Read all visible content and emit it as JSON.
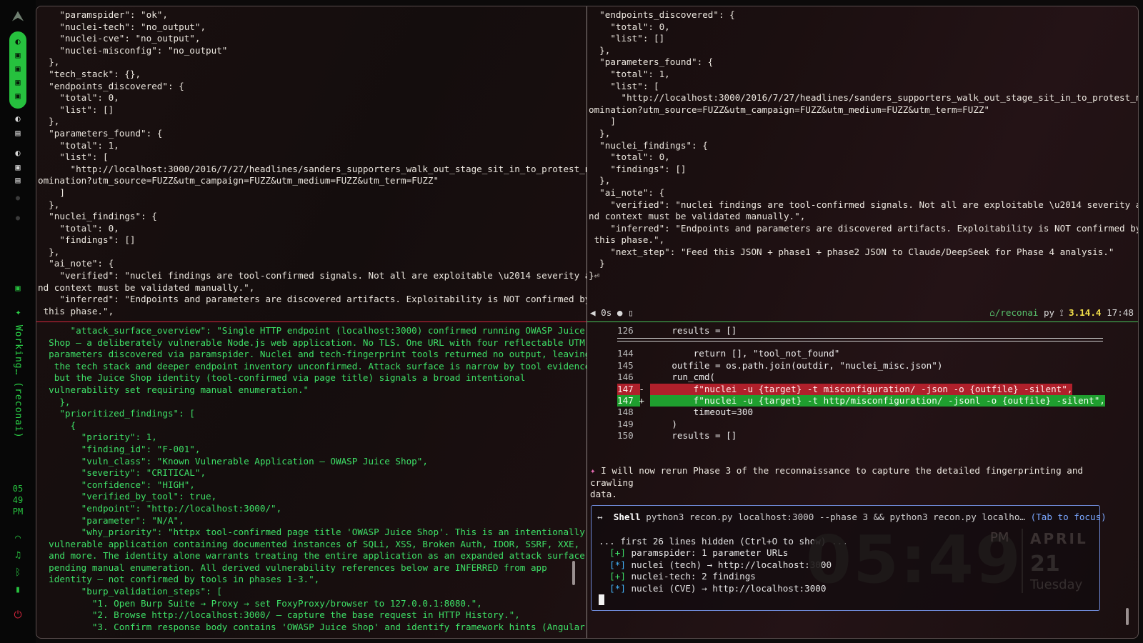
{
  "sidebar": {
    "logo_icon": "arch-logo-icon",
    "status_vertical": "✦ Working… (reconai)",
    "clock": [
      "05",
      "49",
      "PM"
    ],
    "bottom_icons": [
      "wifi-icon",
      "audio-icon",
      "bluetooth-icon",
      "battery-icon",
      "power-icon"
    ]
  },
  "panes": {
    "top_left": {
      "lines": [
        "    \"paramspider\": \"ok\",",
        "    \"nuclei-tech\": \"no_output\",",
        "    \"nuclei-cve\": \"no_output\",",
        "    \"nuclei-misconfig\": \"no_output\"",
        "  },",
        "  \"tech_stack\": {},",
        "  \"endpoints_discovered\": {",
        "    \"total\": 0,",
        "    \"list\": []",
        "  },",
        "  \"parameters_found\": {",
        "    \"total\": 1,",
        "    \"list\": [",
        "      \"http://localhost:3000/2016/7/27/headlines/sanders_supporters_walk_out_stage_sit_in_to_protest_n",
        "omination?utm_source=FUZZ&utm_campaign=FUZZ&utm_medium=FUZZ&utm_term=FUZZ\"",
        "    ]",
        "  },",
        "  \"nuclei_findings\": {",
        "    \"total\": 0,",
        "    \"findings\": []",
        "  },",
        "  \"ai_note\": {",
        "    \"verified\": \"nuclei findings are tool-confirmed signals. Not all are exploitable \\u2014 severity a",
        "nd context must be validated manually.\",",
        "    \"inferred\": \"Endpoints and parameters are discovered artifacts. Exploitability is NOT confirmed by",
        " this phase.\","
      ]
    },
    "top_right": {
      "lines": [
        "  \"endpoints_discovered\": {",
        "    \"total\": 0,",
        "    \"list\": []",
        "  },",
        "  \"parameters_found\": {",
        "    \"total\": 1,",
        "    \"list\": [",
        "      \"http://localhost:3000/2016/7/27/headlines/sanders_supporters_walk_out_stage_sit_in_to_protest_n",
        "omination?utm_source=FUZZ&utm_campaign=FUZZ&utm_medium=FUZZ&utm_term=FUZZ\"",
        "    ]",
        "  },",
        "  \"nuclei_findings\": {",
        "    \"total\": 0,",
        "    \"findings\": []",
        "  },",
        "  \"ai_note\": {",
        "    \"verified\": \"nuclei findings are tool-confirmed signals. Not all are exploitable \\u2014 severity a",
        "nd context must be validated manually.\",",
        "    \"inferred\": \"Endpoints and parameters are discovered artifacts. Exploitability is NOT confirmed by",
        " this phase.\",",
        "    \"next_step\": \"Feed this JSON + phase1 + phase2 JSON to Claude/DeepSeek for Phase 4 analysis.\"",
        "  }",
        "}⏎"
      ],
      "status_left": "◀ 0s ● ▯",
      "status_dir": "⌂/reconai",
      "status_lang": " py ⟟ ",
      "status_pyver": "3.14.4",
      "status_time": " 17:48"
    },
    "bottom_left": {
      "lines": [
        "      \"attack_surface_overview\": \"Single HTTP endpoint (localhost:3000) confirmed running OWASP Juice",
        "  Shop — a deliberately vulnerable Node.js web application. No TLS. One URL with four reflectable UTM",
        "  parameters discovered via paramspider. Nuclei and tech-fingerprint tools returned no output, leaving",
        "   the tech stack and deeper endpoint inventory unconfirmed. Attack surface is narrow by tool evidence",
        "   but the Juice Shop identity (tool-confirmed via page title) signals a broad intentional",
        "  vulnerability set requiring manual enumeration.\"",
        "    },",
        "    \"prioritized_findings\": [",
        "      {",
        "        \"priority\": 1,",
        "        \"finding_id\": \"F-001\",",
        "        \"vuln_class\": \"Known Vulnerable Application — OWASP Juice Shop\",",
        "        \"severity\": \"CRITICAL\",",
        "        \"confidence\": \"HIGH\",",
        "        \"verified_by_tool\": true,",
        "        \"endpoint\": \"http://localhost:3000/\",",
        "        \"parameter\": \"N/A\",",
        "        \"why_priority\": \"httpx tool-confirmed page title 'OWASP Juice Shop'. This is an intentionally",
        "  vulnerable application containing documented instances of SQLi, XSS, Broken Auth, IDOR, SSRF, XXE,",
        "  and more. The identity alone warrants treating the entire application as an expanded attack surface",
        "  pending manual enumeration. All derived vulnerability references below are INFERRED from app",
        "  identity — not confirmed by tools in phases 1-3.\",",
        "        \"burp_validation_steps\": [",
        "          \"1. Open Burp Suite → Proxy → set FoxyProxy/browser to 127.0.0.1:8080.\",",
        "          \"2. Browse http://localhost:3000/ — capture the base request in HTTP History.\",",
        "          \"3. Confirm response body contains 'OWASP Juice Shop' and identify framework hints (Angular"
      ]
    },
    "bottom_right": {
      "diff_lines": [
        {
          "ln": "126",
          "mark": "",
          "pre": "    results = []",
          "kind": "normal"
        },
        {
          "ln": "144",
          "mark": "",
          "pre": "        return [], \"tool_not_found\"",
          "kind": "normal"
        },
        {
          "ln": "145",
          "mark": "",
          "pre": "    outfile = os.path.join(outdir, \"nuclei_misc.json\")",
          "kind": "normal"
        },
        {
          "ln": "146",
          "mark": "",
          "pre": "    run_cmd(",
          "kind": "normal"
        },
        {
          "ln": "147",
          "mark": "-",
          "pre": "        f\"nuclei -u {target} -t misconfiguration/ -json -o {outfile} -silent\",",
          "kind": "del"
        },
        {
          "ln": "147",
          "mark": "+",
          "pre": "        f\"nuclei -u {target} -t http/misconfiguration/ -jsonl -o {outfile} -silent\",",
          "kind": "add"
        },
        {
          "ln": "148",
          "mark": "",
          "pre": "        timeout=300",
          "kind": "normal"
        },
        {
          "ln": "149",
          "mark": "",
          "pre": "    )",
          "kind": "normal"
        },
        {
          "ln": "150",
          "mark": "",
          "pre": "    results = []",
          "kind": "normal"
        }
      ],
      "assistant_star": "✦",
      "assistant_text_1": " I will now rerun Phase 3 of the reconnaissance to capture the detailed fingerprinting and crawling",
      "assistant_text_2": "  data.",
      "shell": {
        "arrow": "↔",
        "label": "Shell",
        "command": " python3 recon.py localhost:3000 --phase 3 && python3 recon.py localho…",
        "focus_hint": "(Tab to focus)",
        "hidden_note": "... first 26 lines hidden (Ctrl+O to show) ...",
        "output": [
          {
            "tag": "[+]",
            "kind": "plus",
            "text": " paramspider: 1 parameter URLs"
          },
          {
            "tag": "[*]",
            "kind": "ast",
            "text": " nuclei (tech) → http://localhost:3000"
          },
          {
            "tag": "[+]",
            "kind": "plus",
            "text": " nuclei-tech: 2 findings"
          },
          {
            "tag": "[*]",
            "kind": "ast",
            "text": " nuclei (CVE) → http://localhost:3000"
          }
        ]
      }
    }
  },
  "wallpaper_clock": {
    "time": "05:49",
    "ampm": "PM",
    "month": "APRIL",
    "day": "21",
    "weekday": "Tuesday"
  },
  "colors": {
    "accent_green": "#26c13e",
    "pane_border_red": "#d7263d",
    "pane_border_green": "#47c55a",
    "diff_del": "#b0202b",
    "diff_add": "#1f9f2f",
    "shell_border": "#6f8ad8"
  }
}
